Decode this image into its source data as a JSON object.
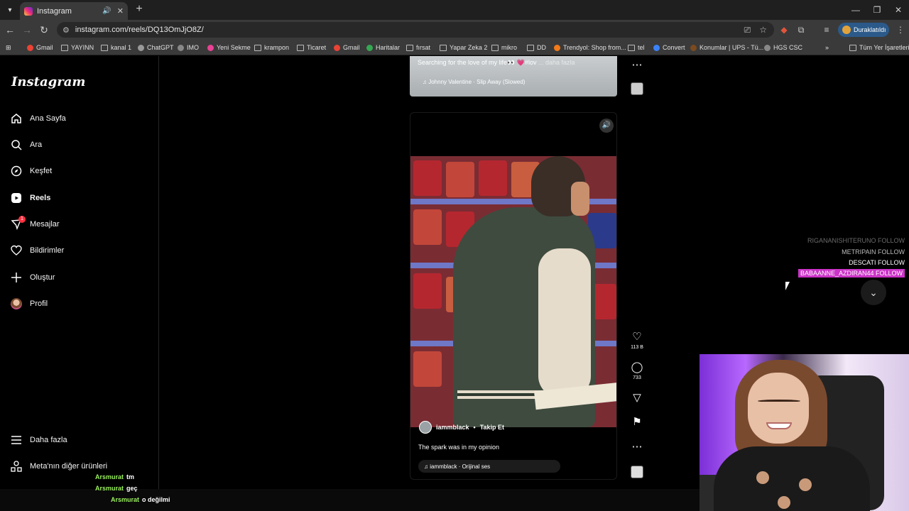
{
  "browser": {
    "tab_title": "Instagram",
    "url": "instagram.com/reels/DQ13OmJjO8Z/",
    "profile_label": "Duraklatıldı",
    "bookmarks": [
      "Gmail",
      "YAYINN",
      "kanal 1",
      "ChatGPT",
      "IMO",
      "Yeni Sekme",
      "krampon",
      "Ticaret",
      "Gmail",
      "Haritalar",
      "fırsat",
      "Yapar Zeka 2",
      "mikro",
      "DD",
      "Trendyol: Shop from...",
      "tel",
      "Convert",
      "Konumlar | UPS - Tü...",
      "HGS CSC"
    ],
    "all_bookmarks": "Tüm Yer İşaretleri"
  },
  "sidebar": {
    "logo": "Instagram",
    "items": [
      {
        "label": "Ana Sayfa",
        "icon": "home-icon"
      },
      {
        "label": "Ara",
        "icon": "search-icon"
      },
      {
        "label": "Keşfet",
        "icon": "compass-icon"
      },
      {
        "label": "Reels",
        "icon": "reels-icon"
      },
      {
        "label": "Mesajlar",
        "icon": "messenger-icon",
        "badge": "1"
      },
      {
        "label": "Bildirimler",
        "icon": "heart-icon"
      },
      {
        "label": "Oluştur",
        "icon": "plus-icon"
      },
      {
        "label": "Profil",
        "icon": "avatar"
      }
    ],
    "more": "Daha fazla",
    "meta": "Meta'nın diğer ürünleri"
  },
  "prev_reel": {
    "caption": "Searching for the love of my life👀 💗#lov",
    "more": " ... daha fazla",
    "audio": "Johnny Valentine · Slip Away (Slowed)"
  },
  "reel": {
    "author": "iammblack",
    "separator": "•",
    "follow": "Takip Et",
    "caption": "The spark was in my opinion",
    "audio": "iammblack · Orijinal ses",
    "likes": "113 B",
    "comments": "733"
  },
  "stream_overlay": {
    "followers": [
      "RIGANANISHITERUNO  FOLLOW",
      "METRIPAIN  FOLLOW",
      "DESCATI  FOLLOW",
      "BABAANNE_AZDIRAN44  FOLLOW"
    ],
    "chat": [
      {
        "user": "Arsmurat",
        "msg": "tm"
      },
      {
        "user": "Arsmurat",
        "msg": "geç"
      },
      {
        "user": "Arsmurat",
        "msg": "o değilmi"
      }
    ]
  },
  "colors": {
    "ig_bg": "#000000",
    "badge_red": "#ff3040",
    "follow_highlight": "#cc33c8",
    "chat_user": "#9af05f"
  }
}
